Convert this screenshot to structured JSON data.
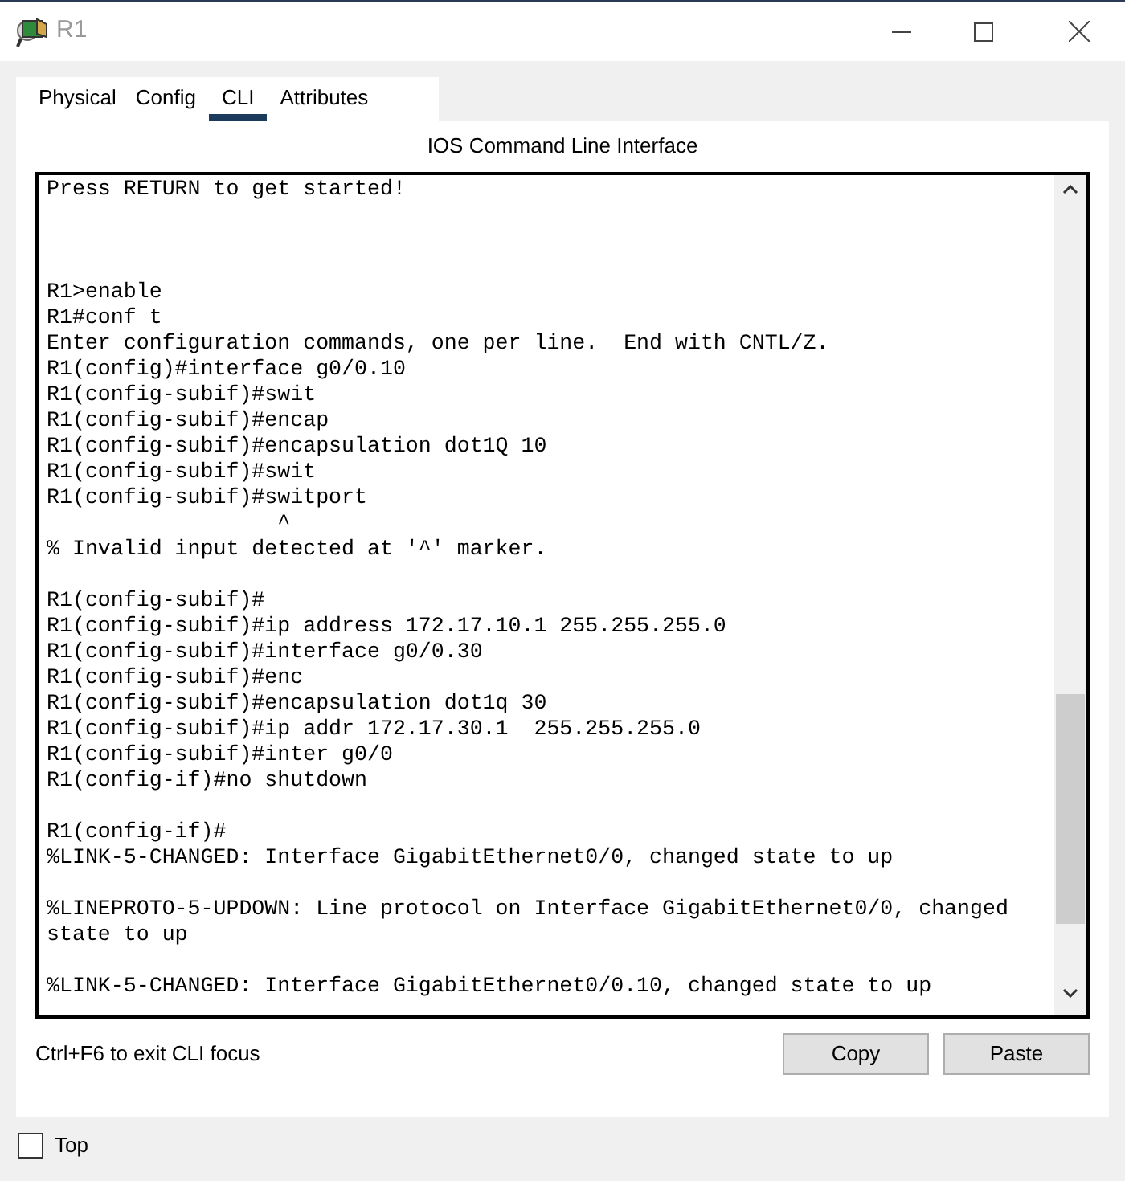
{
  "window": {
    "title": "R1"
  },
  "tabs": [
    {
      "label": "Physical",
      "selected": false
    },
    {
      "label": "Config",
      "selected": false
    },
    {
      "label": "CLI",
      "selected": true
    },
    {
      "label": "Attributes",
      "selected": false
    }
  ],
  "panel_title": "IOS Command Line Interface",
  "terminal": {
    "blocks": [
      {
        "lines": [
          "Press RETURN to get started!"
        ]
      },
      {
        "lines": [
          "R1>enable",
          "R1#conf t",
          "Enter configuration commands, one per line.  End with CNTL/Z.",
          "R1(config)#interface g0/0.10",
          "R1(config-subif)#swit",
          "R1(config-subif)#encap",
          "R1(config-subif)#encapsulation dot1Q 10",
          "R1(config-subif)#swit",
          "R1(config-subif)#switport",
          "                  ^",
          "% Invalid input detected at '^' marker."
        ]
      },
      {
        "lines": [
          "R1(config-subif)#",
          "R1(config-subif)#ip address 172.17.10.1 255.255.255.0",
          "R1(config-subif)#interface g0/0.30",
          "R1(config-subif)#enc",
          "R1(config-subif)#encapsulation dot1q 30",
          "R1(config-subif)#ip addr 172.17.30.1  255.255.255.0",
          "R1(config-subif)#inter g0/0",
          "R1(config-if)#no shutdown"
        ]
      },
      {
        "lines": [
          "R1(config-if)#",
          "%LINK-5-CHANGED: Interface GigabitEthernet0/0, changed state to up"
        ]
      },
      {
        "lines": [
          "%LINEPROTO-5-UPDOWN: Line protocol on Interface GigabitEthernet0/0, changed",
          "state to up"
        ]
      },
      {
        "lines": [
          "%LINK-5-CHANGED: Interface GigabitEthernet0/0.10, changed state to up"
        ]
      }
    ]
  },
  "hint": "Ctrl+F6 to exit CLI focus",
  "buttons": [
    "Copy",
    "Paste"
  ],
  "top_checkbox": {
    "label": "Top",
    "checked": false
  }
}
